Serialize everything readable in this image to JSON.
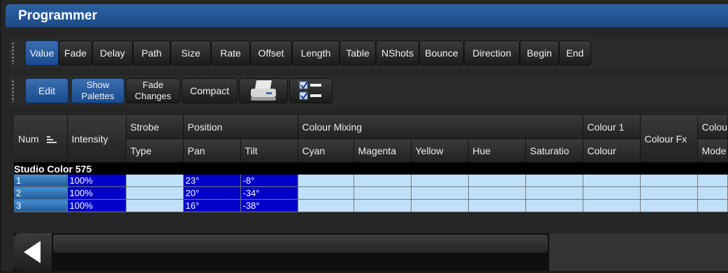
{
  "window": {
    "title": "Programmer"
  },
  "toolbar1": {
    "buttons": [
      "Value",
      "Fade",
      "Delay",
      "Path",
      "Size",
      "Rate",
      "Offset",
      "Length",
      "Table",
      "NShots",
      "Bounce",
      "Direction",
      "Begin",
      "End"
    ],
    "active": "Value"
  },
  "toolbar2": {
    "edit": "Edit",
    "show_palettes": [
      "Show",
      "Palettes"
    ],
    "fade_changes": [
      "Fade",
      "Changes"
    ],
    "compact": "Compact",
    "icons": [
      "print-icon",
      "checklist-icon"
    ]
  },
  "grid": {
    "headers": {
      "num": "Num",
      "intensity": "Intensity",
      "strobe": "Strobe",
      "position": "Position",
      "colour_mixing": "Colour Mixing",
      "colour1": "Colour 1",
      "colour_fx": "Colour Fx",
      "colour_cut": "Colou"
    },
    "subheaders": {
      "type": "Type",
      "pan": "Pan",
      "tilt": "Tilt",
      "cyan": "Cyan",
      "magenta": "Magenta",
      "yellow": "Yellow",
      "hue": "Hue",
      "saturation": "Saturatio",
      "colour": "Colour",
      "mode": "Mode"
    },
    "group": "Studio Color 575",
    "rows": [
      {
        "num": "1",
        "intensity": "100%",
        "pan": "23°",
        "tilt": "-8°"
      },
      {
        "num": "2",
        "intensity": "100%",
        "pan": "20°",
        "tilt": "-34°"
      },
      {
        "num": "3",
        "intensity": "100%",
        "pan": "16°",
        "tilt": "-38°"
      }
    ]
  },
  "colors": {
    "title_bar": "#2d62a6",
    "active_button": "#2a5fa0",
    "selected_cell": "#0000c8",
    "empty_cell": "#bfe0f8"
  }
}
